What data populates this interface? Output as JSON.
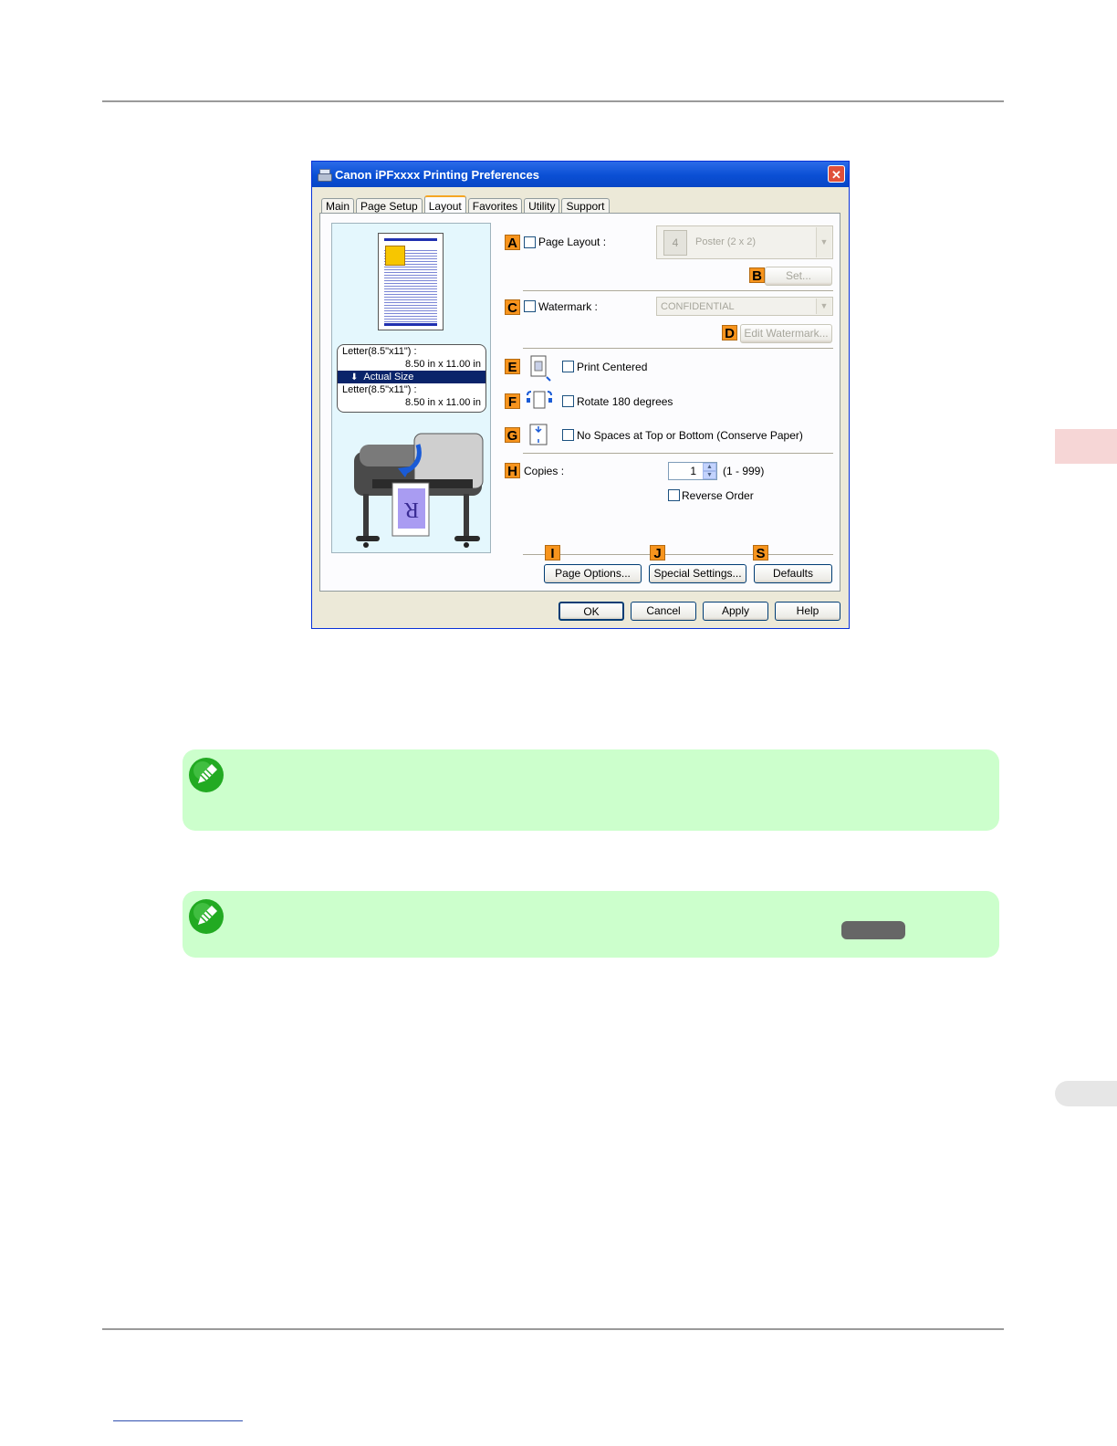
{
  "dialog": {
    "title": "Canon iPFxxxx Printing Preferences",
    "close_label": "✕",
    "tabs": [
      "Main",
      "Page Setup",
      "Layout",
      "Favorites",
      "Utility",
      "Support"
    ],
    "active_tab": "Layout",
    "preview": {
      "rows": [
        {
          "text": "Letter(8.5\"x11\") :"
        },
        {
          "text": "8.50 in x 11.00 in"
        },
        {
          "text": "Actual Size"
        },
        {
          "text": "Letter(8.5\"x11\") :"
        },
        {
          "text": "8.50 in x 11.00 in"
        }
      ]
    },
    "options": {
      "A": {
        "letter": "A",
        "label": "Page Layout :",
        "value": "Poster (2 x 2)",
        "icon_number": "4"
      },
      "B": {
        "letter": "B",
        "button": "Set..."
      },
      "C": {
        "letter": "C",
        "label": "Watermark :",
        "value": "CONFIDENTIAL"
      },
      "D": {
        "letter": "D",
        "button": "Edit Watermark..."
      },
      "E": {
        "letter": "E",
        "label": "Print Centered"
      },
      "F": {
        "letter": "F",
        "label": "Rotate 180 degrees"
      },
      "G": {
        "letter": "G",
        "label": "No Spaces at Top or Bottom (Conserve Paper)"
      },
      "H": {
        "letter": "H",
        "label": "Copies :",
        "value": "1",
        "range": "(1 - 999)",
        "reverse_label": "Reverse Order"
      },
      "I": {
        "letter": "I",
        "button": "Page Options..."
      },
      "J": {
        "letter": "J",
        "button": "Special Settings..."
      },
      "S": {
        "letter": "S",
        "button": "Defaults"
      }
    },
    "footer": {
      "ok": "OK",
      "cancel": "Cancel",
      "apply": "Apply",
      "help": "Help"
    }
  },
  "colors": {
    "accent": "#f7941d",
    "titlebar": "#0a4fd4",
    "note_bg": "#ccffcc"
  }
}
